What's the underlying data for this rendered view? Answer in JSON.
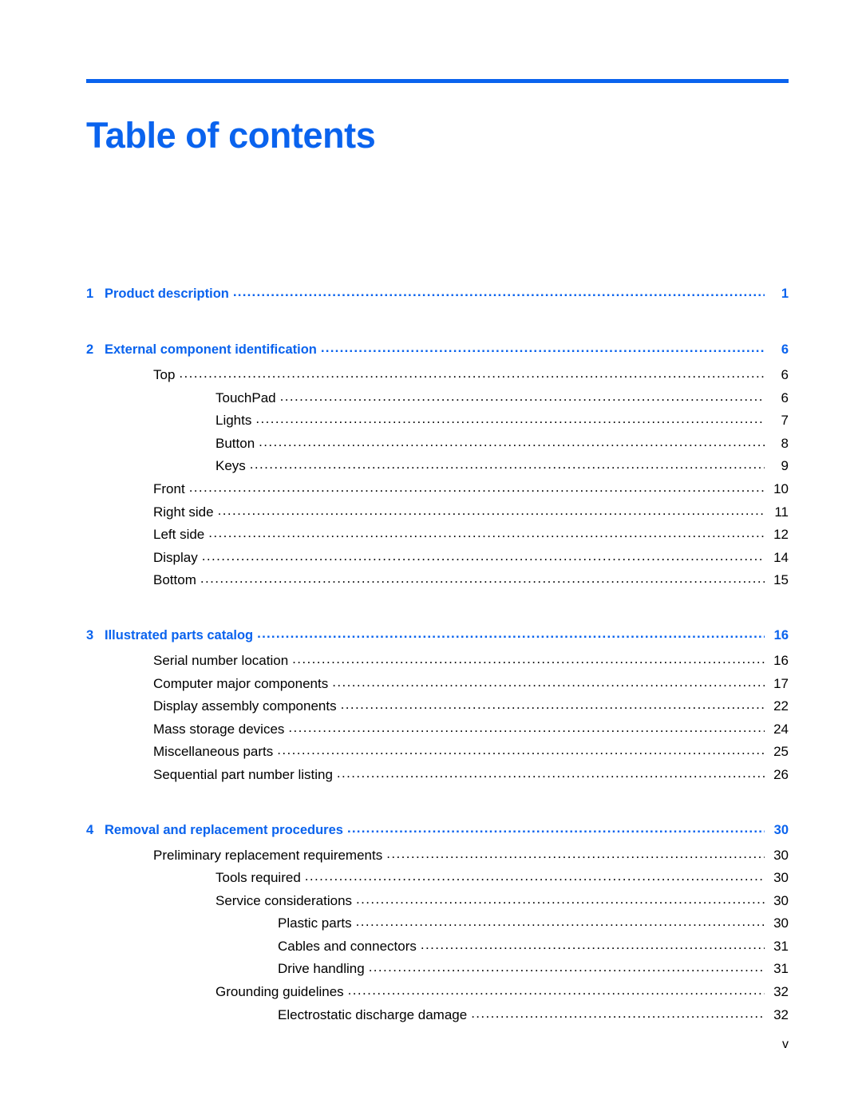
{
  "document": {
    "title": "Table of contents",
    "accent_color": "#0a63ee",
    "footer_page_number": "v"
  },
  "toc": {
    "entries": [
      {
        "level": "chapter",
        "number": "1",
        "label": "Product description",
        "page": "1"
      },
      {
        "level": "chapter",
        "number": "2",
        "label": "External component identification",
        "page": "6"
      },
      {
        "level": "1",
        "label": "Top",
        "page": "6"
      },
      {
        "level": "2",
        "label": "TouchPad",
        "page": "6"
      },
      {
        "level": "2",
        "label": "Lights",
        "page": "7"
      },
      {
        "level": "2",
        "label": "Button",
        "page": "8"
      },
      {
        "level": "2",
        "label": "Keys",
        "page": "9"
      },
      {
        "level": "1",
        "label": "Front",
        "page": "10"
      },
      {
        "level": "1",
        "label": "Right side",
        "page": "11"
      },
      {
        "level": "1",
        "label": "Left side",
        "page": "12"
      },
      {
        "level": "1",
        "label": "Display",
        "page": "14"
      },
      {
        "level": "1",
        "label": "Bottom",
        "page": "15"
      },
      {
        "level": "chapter",
        "number": "3",
        "label": "Illustrated parts catalog",
        "page": "16"
      },
      {
        "level": "1",
        "label": "Serial number location",
        "page": "16"
      },
      {
        "level": "1",
        "label": "Computer major components",
        "page": "17"
      },
      {
        "level": "1",
        "label": "Display assembly components",
        "page": "22"
      },
      {
        "level": "1",
        "label": "Mass storage devices",
        "page": "24"
      },
      {
        "level": "1",
        "label": "Miscellaneous parts",
        "page": "25"
      },
      {
        "level": "1",
        "label": "Sequential part number listing",
        "page": "26"
      },
      {
        "level": "chapter",
        "number": "4",
        "label": "Removal and replacement procedures",
        "page": "30"
      },
      {
        "level": "1",
        "label": "Preliminary replacement requirements",
        "page": "30"
      },
      {
        "level": "2",
        "label": "Tools required",
        "page": "30"
      },
      {
        "level": "2",
        "label": "Service considerations",
        "page": "30"
      },
      {
        "level": "3",
        "label": "Plastic parts",
        "page": "30"
      },
      {
        "level": "3",
        "label": "Cables and connectors",
        "page": "31"
      },
      {
        "level": "3",
        "label": "Drive handling",
        "page": "31"
      },
      {
        "level": "2",
        "label": "Grounding guidelines",
        "page": "32"
      },
      {
        "level": "3",
        "label": "Electrostatic discharge damage",
        "page": "32"
      }
    ]
  }
}
